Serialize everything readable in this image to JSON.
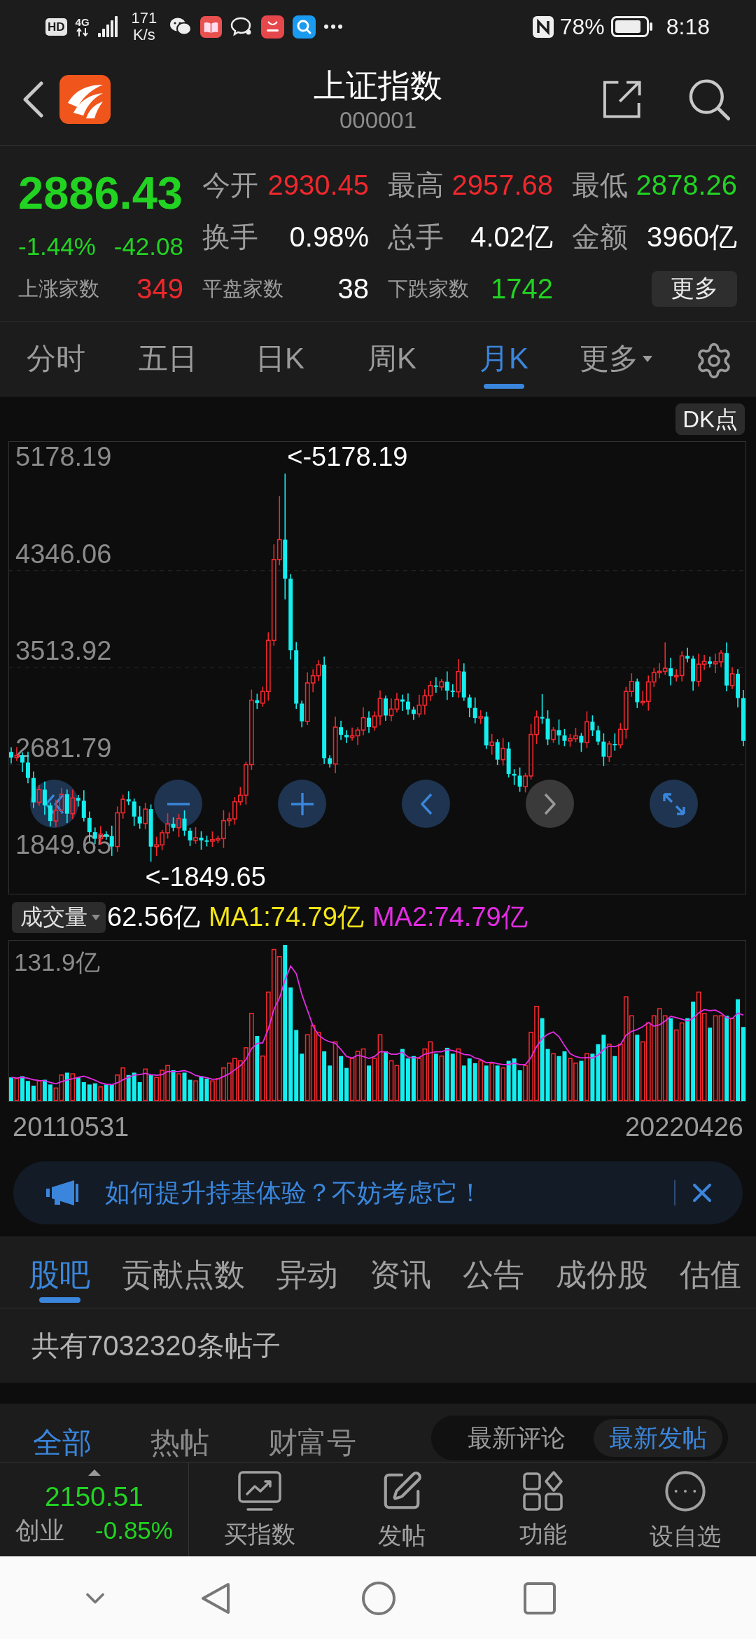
{
  "status_bar": {
    "hd_badge": "HD",
    "network": "4G",
    "net_speed": "171",
    "net_speed_unit": "K/s",
    "battery": "78%",
    "time": "8:18"
  },
  "header": {
    "title": "上证指数",
    "code": "000001"
  },
  "quote": {
    "price": "2886.43",
    "change_percent": "-1.44%",
    "change": "-42.08",
    "falling": true
  },
  "stats": [
    {
      "label": "今开",
      "value": "2930.45",
      "color": "#f0282d"
    },
    {
      "label": "最高",
      "value": "2957.68",
      "color": "#f0282d"
    },
    {
      "label": "最低",
      "value": "2878.26",
      "color": "#22d322"
    },
    {
      "label": "换手",
      "value": "0.98%",
      "color": "#ffffff"
    },
    {
      "label": "总手",
      "value": "4.02亿",
      "color": "#ffffff"
    },
    {
      "label": "金额",
      "value": "3960亿",
      "color": "#ffffff"
    }
  ],
  "breadth": [
    {
      "label": "上涨家数",
      "value": "349",
      "color": "#f0282d"
    },
    {
      "label": "平盘家数",
      "value": "38",
      "color": "#ffffff"
    },
    {
      "label": "下跌家数",
      "value": "1742",
      "color": "#22d322"
    }
  ],
  "more_button": "更多",
  "period_tabs": [
    {
      "label": "分时",
      "selected": false,
      "kind": "tab"
    },
    {
      "label": "五日",
      "selected": false,
      "kind": "tab"
    },
    {
      "label": "日K",
      "selected": false,
      "kind": "tab"
    },
    {
      "label": "周K",
      "selected": false,
      "kind": "tab"
    },
    {
      "label": "月K",
      "selected": true,
      "kind": "tab"
    },
    {
      "label": "更多",
      "selected": false,
      "kind": "menu"
    }
  ],
  "kline": {
    "dk_button": "DK点",
    "chart_data": {
      "type": "candlestick",
      "ohlc": [
        [
          2790,
          2830,
          2693,
          2743
        ],
        [
          2743,
          2832,
          2713,
          2762
        ],
        [
          2762,
          2787,
          2621,
          2701
        ],
        [
          2701,
          2791,
          2523,
          2568
        ],
        [
          2568,
          2623,
          2309,
          2359
        ],
        [
          2359,
          2508,
          2329,
          2468
        ],
        [
          2468,
          2538,
          2253,
          2333
        ],
        [
          2333,
          2358,
          2154,
          2199
        ],
        [
          2199,
          2382,
          2149,
          2292
        ],
        [
          2292,
          2483,
          2262,
          2428
        ],
        [
          2428,
          2468,
          2182,
          2262
        ],
        [
          2262,
          2467,
          2217,
          2397
        ],
        [
          2397,
          2422,
          2323,
          2373
        ],
        [
          2373,
          2463,
          2195,
          2225
        ],
        [
          2225,
          2280,
          2023,
          2103
        ],
        [
          2103,
          2143,
          2002,
          2047
        ],
        [
          2047,
          2156,
          1997,
          2086
        ],
        [
          2086,
          2111,
          2039,
          2069
        ],
        [
          2069,
          2159,
          1900,
          1980
        ],
        [
          1980,
          2324,
          1935,
          2269
        ],
        [
          2269,
          2425,
          2219,
          2385
        ],
        [
          2385,
          2455,
          2336,
          2366
        ],
        [
          2366,
          2391,
          2157,
          2237
        ],
        [
          2237,
          2327,
          2133,
          2178
        ],
        [
          2178,
          2356,
          2128,
          2301
        ],
        [
          2301,
          2341,
          1849.65,
          1979
        ],
        [
          1979,
          2064,
          1899,
          1994
        ],
        [
          1994,
          2123,
          1949,
          2098
        ],
        [
          2098,
          2265,
          2048,
          2175
        ],
        [
          2175,
          2230,
          2111,
          2141
        ],
        [
          2141,
          2260,
          2061,
          2220
        ],
        [
          2220,
          2290,
          2071,
          2116
        ],
        [
          2116,
          2141,
          1983,
          2033
        ],
        [
          2033,
          2146,
          2003,
          2056
        ],
        [
          2056,
          2111,
          1953,
          2033
        ],
        [
          2033,
          2073,
          1981,
          2026
        ],
        [
          2026,
          2109,
          1976,
          2039
        ],
        [
          2039,
          2073,
          2009,
          2048
        ],
        [
          2048,
          2292,
          1968,
          2202
        ],
        [
          2202,
          2272,
          2157,
          2217
        ],
        [
          2217,
          2404,
          2167,
          2364
        ],
        [
          2364,
          2490,
          2334,
          2420
        ],
        [
          2420,
          2708,
          2340,
          2683
        ],
        [
          2683,
          3325,
          2638,
          3235
        ],
        [
          3235,
          3290,
          3160,
          3210
        ],
        [
          3210,
          3350,
          3180,
          3310
        ],
        [
          3310,
          3818,
          3230,
          3748
        ],
        [
          3748,
          4572,
          3703,
          4442
        ],
        [
          4442,
          4986,
          4392,
          4612
        ],
        [
          4612,
          5178.19,
          4100,
          4277
        ],
        [
          4277,
          4317,
          3584,
          3664
        ],
        [
          3664,
          3734,
          3161,
          3206
        ],
        [
          3206,
          3231,
          3003,
          3053
        ],
        [
          3053,
          3473,
          3023,
          3383
        ],
        [
          3383,
          3500,
          3303,
          3445
        ],
        [
          3445,
          3579,
          3400,
          3539
        ],
        [
          3539,
          3609,
          2688,
          2738
        ],
        [
          2738,
          2763,
          2658,
          2688
        ],
        [
          2688,
          3094,
          2608,
          3004
        ],
        [
          3004,
          3059,
          2893,
          2938
        ],
        [
          2938,
          2978,
          2867,
          2917
        ],
        [
          2917,
          3000,
          2887,
          2930
        ],
        [
          2930,
          3004,
          2850,
          2979
        ],
        [
          2979,
          3175,
          2934,
          3085
        ],
        [
          3085,
          3140,
          2955,
          3005
        ],
        [
          3005,
          3140,
          2975,
          3100
        ],
        [
          3100,
          3320,
          3020,
          3250
        ],
        [
          3250,
          3275,
          3059,
          3104
        ],
        [
          3104,
          3249,
          3054,
          3159
        ],
        [
          3159,
          3297,
          3129,
          3242
        ],
        [
          3242,
          3282,
          3143,
          3223
        ],
        [
          3223,
          3293,
          3110,
          3155
        ],
        [
          3155,
          3180,
          3067,
          3117
        ],
        [
          3117,
          3282,
          3087,
          3192
        ],
        [
          3192,
          3328,
          3112,
          3273
        ],
        [
          3273,
          3401,
          3228,
          3361
        ],
        [
          3361,
          3431,
          3299,
          3349
        ],
        [
          3349,
          3418,
          3319,
          3393
        ],
        [
          3393,
          3483,
          3237,
          3317
        ],
        [
          3317,
          3372,
          3262,
          3307
        ],
        [
          3307,
          3587,
          3257,
          3481
        ],
        [
          3481,
          3551,
          3229,
          3259
        ],
        [
          3259,
          3284,
          3089,
          3169
        ],
        [
          3169,
          3259,
          3037,
          3082
        ],
        [
          3082,
          3150,
          3032,
          3095
        ],
        [
          3095,
          3135,
          2817,
          2847
        ],
        [
          2847,
          2946,
          2767,
          2876
        ],
        [
          2876,
          2901,
          2680,
          2725
        ],
        [
          2725,
          2911,
          2675,
          2821
        ],
        [
          2821,
          2876,
          2573,
          2603
        ],
        [
          2603,
          2643,
          2508,
          2588
        ],
        [
          2588,
          2658,
          2449,
          2494
        ],
        [
          2494,
          2610,
          2444,
          2585
        ],
        [
          2585,
          3031,
          2555,
          2941
        ],
        [
          2941,
          3146,
          2861,
          3091
        ],
        [
          3091,
          3288,
          3033,
          3078
        ],
        [
          3078,
          3148,
          2849,
          2899
        ],
        [
          2899,
          3004,
          2869,
          2979
        ],
        [
          2979,
          3069,
          2853,
          2933
        ],
        [
          2933,
          2988,
          2841,
          2886
        ],
        [
          2886,
          2945,
          2836,
          2905
        ],
        [
          2905,
          2999,
          2875,
          2929
        ],
        [
          2929,
          2954,
          2791,
          2871
        ],
        [
          2871,
          3140,
          2826,
          3050
        ],
        [
          3050,
          3105,
          2927,
          2977
        ],
        [
          2977,
          3017,
          2850,
          2880
        ],
        [
          2880,
          2950,
          2670,
          2750
        ],
        [
          2750,
          2885,
          2705,
          2860
        ],
        [
          2860,
          2950,
          2802,
          2852
        ],
        [
          2852,
          3040,
          2822,
          2985
        ],
        [
          2985,
          3350,
          2905,
          3310
        ],
        [
          3310,
          3466,
          3265,
          3396
        ],
        [
          3396,
          3421,
          3168,
          3218
        ],
        [
          3218,
          3315,
          3188,
          3225
        ],
        [
          3225,
          3447,
          3145,
          3392
        ],
        [
          3392,
          3513,
          3347,
          3473
        ],
        [
          3473,
          3553,
          3423,
          3483
        ],
        [
          3483,
          3731,
          3453,
          3509
        ],
        [
          3509,
          3599,
          3362,
          3442
        ],
        [
          3442,
          3502,
          3397,
          3447
        ],
        [
          3447,
          3655,
          3397,
          3615
        ],
        [
          3615,
          3685,
          3561,
          3591
        ],
        [
          3591,
          3616,
          3317,
          3397
        ],
        [
          3397,
          3634,
          3352,
          3544
        ],
        [
          3544,
          3623,
          3494,
          3568
        ],
        [
          3568,
          3608,
          3517,
          3547
        ],
        [
          3547,
          3634,
          3467,
          3564
        ],
        [
          3564,
          3665,
          3519,
          3640
        ],
        [
          3640,
          3730,
          3311,
          3361
        ],
        [
          3361,
          3517,
          3331,
          3462
        ],
        [
          3462,
          3502,
          3173,
          3253
        ],
        [
          3253,
          3323,
          2841,
          2886
        ]
      ],
      "ylim": [
        1575,
        5450
      ],
      "yticks": [
        {
          "value": 5178.19,
          "label": "5178.19"
        },
        {
          "value": 4346.06,
          "label": "4346.06"
        },
        {
          "value": 3513.92,
          "label": "3513.92"
        },
        {
          "value": 2681.79,
          "label": "2681.79"
        },
        {
          "value": 1849.65,
          "label": "1849.65"
        }
      ],
      "grid": true,
      "annotations": [
        "<-5178.19",
        "<-1849.65"
      ]
    },
    "controls": [
      {
        "kind": "rewind",
        "disabled": false
      },
      {
        "kind": "zoom_out",
        "disabled": false
      },
      {
        "kind": "zoom_in",
        "disabled": false
      },
      {
        "kind": "back",
        "disabled": false
      },
      {
        "kind": "forward",
        "disabled": true
      },
      {
        "kind": "fullscreen",
        "disabled": false
      }
    ]
  },
  "volume": {
    "selector": "成交量",
    "value": "62.56亿",
    "ma1": "MA1:74.79亿",
    "ma2": "MA2:74.79亿",
    "max_label": "131.9亿",
    "start_date": "20110531",
    "end_date": "20220426"
  },
  "notice": {
    "text": "如何提升持基体验？不妨考虑它！"
  },
  "info_tabs": [
    {
      "label": "股吧",
      "selected": true
    },
    {
      "label": "贡献点数",
      "selected": false
    },
    {
      "label": "异动",
      "selected": false
    },
    {
      "label": "资讯",
      "selected": false
    },
    {
      "label": "公告",
      "selected": false
    },
    {
      "label": "成份股",
      "selected": false
    },
    {
      "label": "估值",
      "selected": false
    }
  ],
  "post_count": "共有7032320条帖子",
  "post_filters": [
    {
      "label": "全部",
      "selected": true
    },
    {
      "label": "热帖",
      "selected": false
    },
    {
      "label": "财富号",
      "selected": false
    }
  ],
  "sort_options": [
    {
      "label": "最新评论",
      "selected": false
    },
    {
      "label": "最新发帖",
      "selected": true
    }
  ],
  "bottom_bar": {
    "ticker": {
      "value": "2150.51",
      "name": "创业",
      "change": "-0.85%",
      "falling": true
    },
    "actions": [
      {
        "kind": "chart",
        "label": "买指数"
      },
      {
        "kind": "post",
        "label": "发帖"
      },
      {
        "kind": "apps",
        "label": "功能"
      },
      {
        "kind": "more",
        "label": "设自选"
      }
    ]
  }
}
